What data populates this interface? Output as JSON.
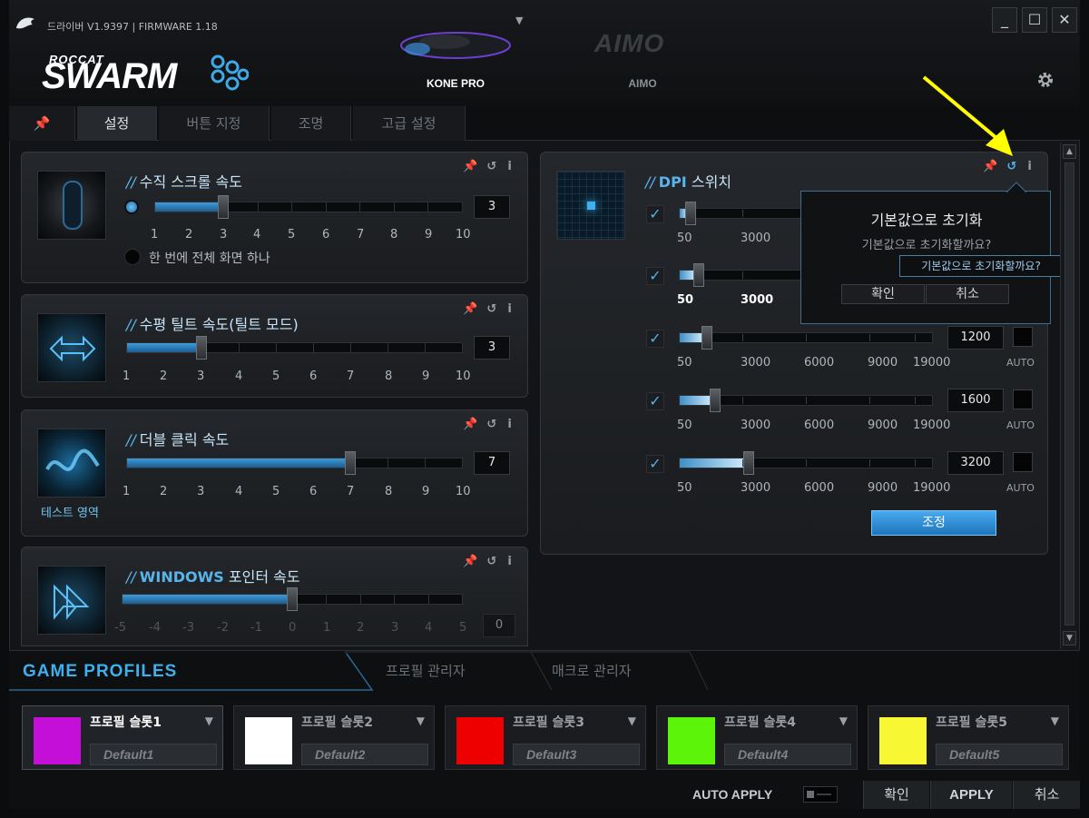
{
  "app": {
    "version_text": "드라이버 V1.9397 | FIRMWARE 1.18",
    "brand_top": "ROCCAT",
    "brand_main": "SWARM"
  },
  "devices": [
    {
      "label": "KONE PRO"
    },
    {
      "label": "AIMO",
      "logo_text": "AIMO"
    }
  ],
  "window_buttons": {
    "minimize": "_",
    "maximize": "☐",
    "close": "✕"
  },
  "tabs": [
    {
      "label": ""
    },
    {
      "label": "설정"
    },
    {
      "label": "버튼 지정"
    },
    {
      "label": "조명"
    },
    {
      "label": "고급 설정"
    }
  ],
  "panels": {
    "vertical_scroll": {
      "title_prefix": "//",
      "title": "수직 스크롤 속도",
      "value": "3",
      "level": 3,
      "ticks": [
        "1",
        "2",
        "3",
        "4",
        "5",
        "6",
        "7",
        "8",
        "9",
        "10"
      ],
      "option_label": "한 번에 전체 화면 하나"
    },
    "horizontal_tilt": {
      "title_prefix": "//",
      "title": "수평 틸트 속도(틸트 모드)",
      "value": "3",
      "level": 3,
      "ticks": [
        "1",
        "2",
        "3",
        "4",
        "5",
        "6",
        "7",
        "8",
        "9",
        "10"
      ]
    },
    "double_click": {
      "title_prefix": "//",
      "title": "더블 클릭 속도",
      "value": "7",
      "level": 7,
      "ticks": [
        "1",
        "2",
        "3",
        "4",
        "5",
        "6",
        "7",
        "8",
        "9",
        "10"
      ],
      "test_area_label": "테스트 영역"
    },
    "windows_pointer": {
      "title_prefix": "//",
      "title_strong": "WINDOWS",
      "title": "포인터 속도",
      "value": "0",
      "level": 0,
      "ticks": [
        "-5",
        "-4",
        "-3",
        "-2",
        "-1",
        "0",
        "1",
        "2",
        "3",
        "4",
        "5"
      ]
    },
    "dpi": {
      "title_prefix": "//",
      "title_strong": "DPI",
      "title": "스위치",
      "ticks": [
        "50",
        "3000",
        "6000",
        "9000",
        "19000"
      ],
      "rows": [
        {
          "value": "",
          "dpi": 400
        },
        {
          "value": "",
          "dpi": 800
        },
        {
          "value": "1200",
          "dpi": 1200
        },
        {
          "value": "1600",
          "dpi": 1600
        },
        {
          "value": "3200",
          "dpi": 3200
        }
      ],
      "auto_label": "AUTO",
      "adjust_button": "조정"
    }
  },
  "reset_dialog": {
    "title": "기본값으로 초기화",
    "message": "기본값으로 초기화할까요?",
    "confirm": "확인",
    "cancel": "취소",
    "tooltip": "기본값으로 초기화할까요?"
  },
  "bottom": {
    "section_title": "GAME PROFILES",
    "sub_tabs": [
      "프로필 관리자",
      "매크로 관리자"
    ],
    "slots": [
      {
        "name": "프로필 슬롯1",
        "default": "Default1",
        "color": "#c30fd8"
      },
      {
        "name": "프로필 슬롯2",
        "default": "Default2",
        "color": "#ffffff"
      },
      {
        "name": "프로필 슬롯3",
        "default": "Default3",
        "color": "#ef0000"
      },
      {
        "name": "프로필 슬롯4",
        "default": "Default4",
        "color": "#5cf50a"
      },
      {
        "name": "프로필 슬롯5",
        "default": "Default5",
        "color": "#f7f734"
      }
    ],
    "auto_apply_label": "AUTO APPLY",
    "ok": "확인",
    "apply": "APPLY",
    "cancel": "취소"
  },
  "accent_color": "#3fb0ee",
  "annotation_arrow_color": "#ffff00"
}
